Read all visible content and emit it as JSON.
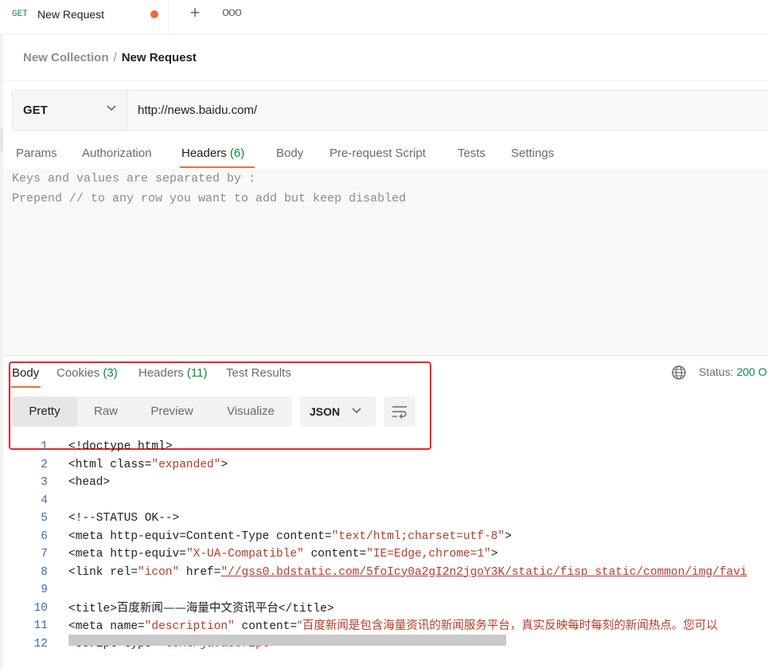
{
  "tab": {
    "method": "GET",
    "name": "New Request"
  },
  "breadcrumb": {
    "collection": "New Collection",
    "separator": "/",
    "request": "New Request"
  },
  "request": {
    "method": "GET",
    "url": "http://news.baidu.com/"
  },
  "request_tabs": [
    {
      "label": "Params"
    },
    {
      "label": "Authorization"
    },
    {
      "label": "Headers",
      "count": "(6)"
    },
    {
      "label": "Body"
    },
    {
      "label": "Pre-request Script"
    },
    {
      "label": "Tests"
    },
    {
      "label": "Settings"
    }
  ],
  "bulk_hints": [
    "Keys and values are separated by :",
    "Prepend // to any row you want to add but keep disabled"
  ],
  "response_tabs": [
    {
      "label": "Body"
    },
    {
      "label": "Cookies",
      "count": "(3)"
    },
    {
      "label": "Headers",
      "count": "(11)"
    },
    {
      "label": "Test Results"
    }
  ],
  "status": {
    "label": "Status:",
    "code": "200 O"
  },
  "view_modes": [
    "Pretty",
    "Raw",
    "Preview",
    "Visualize"
  ],
  "format": "JSON",
  "icons": {
    "globe": "globe-icon",
    "wrap": "wrap-lines-icon",
    "chevron": "chevron-down-icon",
    "plus": "plus-icon",
    "more": "more-icon"
  },
  "colors": {
    "accent": "#f26b3a",
    "green": "#0a8a3c",
    "string": "#b83b28",
    "line_number": "#3d6fa8",
    "highlight": "#e8262b"
  },
  "code_lines": [
    {
      "n": "1",
      "parts": [
        {
          "t": "<!doctype html>"
        }
      ]
    },
    {
      "n": "2",
      "parts": [
        {
          "t": "<html class="
        },
        {
          "t": "\"expanded\"",
          "s": true
        },
        {
          "t": ">"
        }
      ]
    },
    {
      "n": "3",
      "parts": [
        {
          "t": "<head>"
        }
      ]
    },
    {
      "n": "4",
      "parts": []
    },
    {
      "n": "5",
      "parts": [
        {
          "t": "<!--STATUS OK-->"
        }
      ]
    },
    {
      "n": "6",
      "parts": [
        {
          "t": "<meta http-equiv=Content-Type content="
        },
        {
          "t": "\"text/html;charset=utf-8\"",
          "s": true
        },
        {
          "t": ">"
        }
      ]
    },
    {
      "n": "7",
      "parts": [
        {
          "t": "<meta http-equiv="
        },
        {
          "t": "\"X-UA-Compatible\"",
          "s": true
        },
        {
          "t": " content="
        },
        {
          "t": "\"IE=Edge,chrome=1\"",
          "s": true
        },
        {
          "t": ">"
        }
      ]
    },
    {
      "n": "8",
      "parts": [
        {
          "t": "<link rel="
        },
        {
          "t": "\"icon\"",
          "s": true
        },
        {
          "t": " href="
        },
        {
          "t": "\"//gss0.bdstatic.com/5foIcy0a2gI2n2jgoY3K/static/fisp_static/common/img/favi",
          "s": true
        }
      ]
    },
    {
      "n": "9",
      "parts": []
    },
    {
      "n": "10",
      "parts": [
        {
          "t": "<title>"
        },
        {
          "t": "百度新闻——海量中文资讯平台",
          "c": true
        },
        {
          "t": "</title>"
        }
      ]
    },
    {
      "n": "11",
      "parts": [
        {
          "t": "<meta name="
        },
        {
          "t": "\"description\"",
          "s": true
        },
        {
          "t": " content="
        },
        {
          "t": "\"百度新闻是包含海量资讯的新闻服务平台，真实反映每时每刻的新闻热点。您可以",
          "s": true,
          "c": true
        }
      ]
    },
    {
      "n": "12",
      "parts": [
        {
          "t": "<script type="
        },
        {
          "t": "\"text/javascript\"",
          "s": true
        },
        {
          "t": ">"
        }
      ]
    }
  ]
}
